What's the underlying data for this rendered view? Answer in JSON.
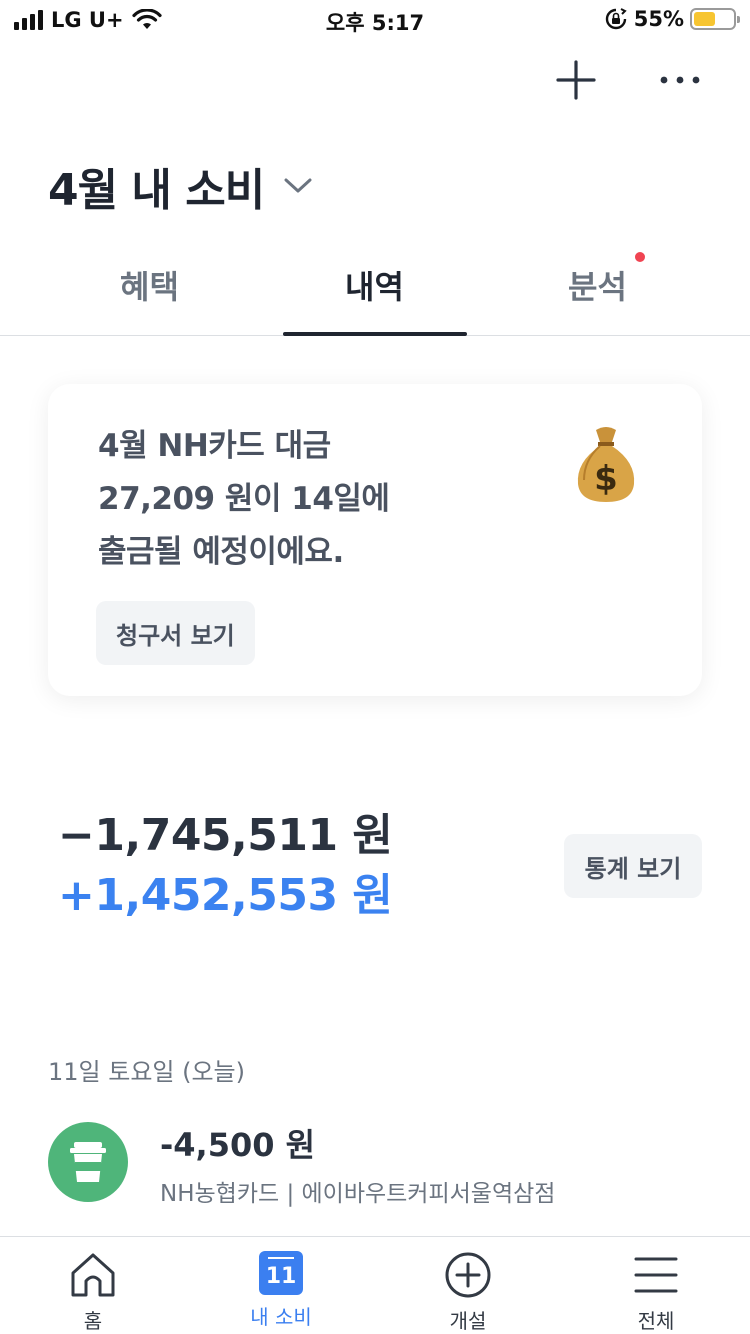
{
  "status_bar": {
    "carrier": "LG U+",
    "time": "오후 5:17",
    "battery_percent": "55%",
    "battery_level": 0.55,
    "battery_color": "#f7c531"
  },
  "header": {
    "add_icon": "plus-icon",
    "more_icon": "more-dots-icon",
    "title": "4월 내 소비",
    "dropdown_icon": "chevron-down-icon"
  },
  "tabs": [
    {
      "label": "혜택",
      "active": false,
      "has_dot": false
    },
    {
      "label": "내역",
      "active": true,
      "has_dot": false
    },
    {
      "label": "분석",
      "active": false,
      "has_dot": true
    }
  ],
  "bill_card": {
    "lines": [
      "4월 NH카드 대금",
      "27,209 원이 14일에",
      "출금될 예정이에요."
    ],
    "icon": "money-bag-icon",
    "button_label": "청구서 보기"
  },
  "totals": {
    "outgoing": "−1,745,511 원",
    "incoming": "+1,452,553 원",
    "incoming_color": "#3b82f0",
    "stats_button_label": "통계 보기"
  },
  "days": [
    {
      "header": "11일 토요일 (오늘)",
      "transactions": [
        {
          "amount": "-4,500 원",
          "description": "NH농협카드 | 에이바우트커피서울역삼점",
          "icon": "coffee-cup-icon",
          "icon_color": "#4fb57a"
        }
      ]
    }
  ],
  "bottom_nav": [
    {
      "label": "홈",
      "icon": "home-icon",
      "active": false
    },
    {
      "label": "내 소비",
      "icon": "calendar-icon",
      "icon_text": "11",
      "active": true
    },
    {
      "label": "개설",
      "icon": "plus-circle-icon",
      "active": false
    },
    {
      "label": "전체",
      "icon": "menu-icon",
      "active": false
    }
  ],
  "colors": {
    "accent": "#3b7ff0",
    "alert_dot": "#f04452"
  }
}
